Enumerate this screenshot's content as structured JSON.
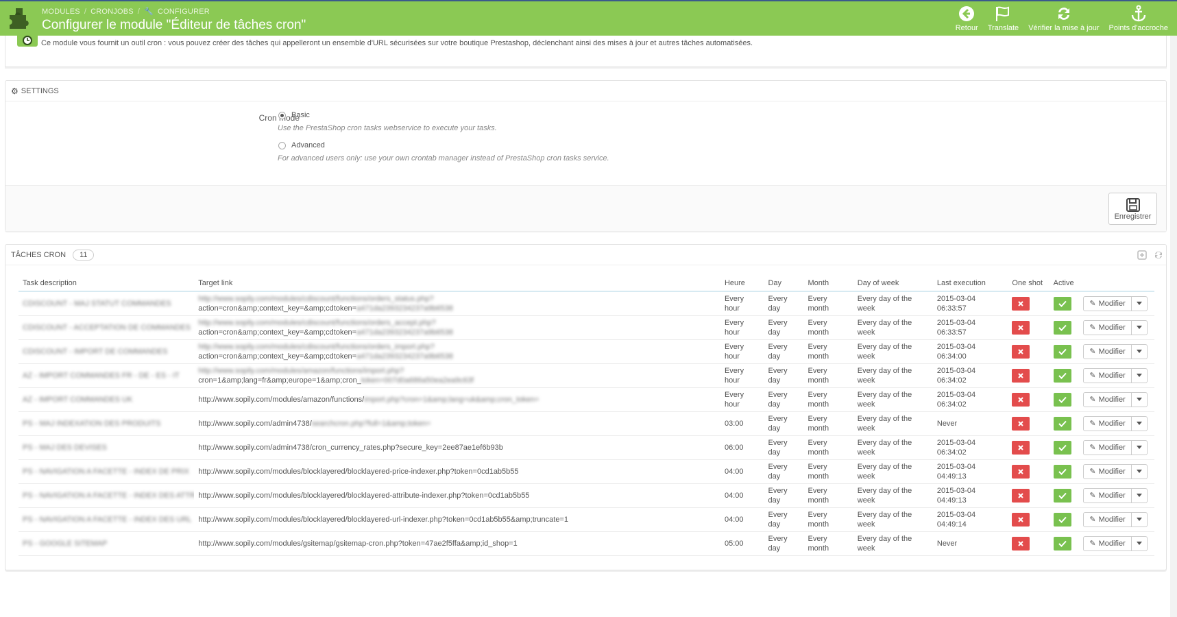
{
  "header": {
    "breadcrumb": [
      "MODULES",
      "CRONJOBS",
      "CONFIGURER"
    ],
    "title": "Configurer le module \"Éditeur de tâches cron\"",
    "toolbar": [
      {
        "label": "Retour",
        "icon": "back-icon"
      },
      {
        "label": "Translate",
        "icon": "flag-icon"
      },
      {
        "label": "Vérifier la mise à jour",
        "icon": "refresh-icon"
      },
      {
        "label": "Points d'accroche",
        "icon": "anchor-icon"
      }
    ]
  },
  "intro": {
    "text": "Ce module vous fournit un outil cron : vous pouvez créer des tâches qui appelleront un ensemble d'URL sécurisées sur votre boutique Prestashop, déclenchant ainsi des mises à jour et autres tâches automatisées."
  },
  "settings": {
    "heading": "SETTINGS",
    "cron_mode_label": "Cron mode",
    "options": [
      {
        "label": "Basic",
        "help": "Use the PrestaShop cron tasks webservice to execute your tasks.",
        "checked": true
      },
      {
        "label": "Advanced",
        "help": "For advanced users only: use your own crontab manager instead of PrestaShop cron tasks service.",
        "checked": false
      }
    ],
    "save_label": "Enregistrer"
  },
  "tasks": {
    "heading": "TÂCHES CRON",
    "count": "11",
    "columns": [
      "Task description",
      "Target link",
      "Heure",
      "Day",
      "Month",
      "Day of week",
      "Last execution",
      "One shot",
      "Active",
      ""
    ],
    "edit_label": "Modifier",
    "rows": [
      {
        "desc": "CDISCOUNT - MAJ STATUT COMMANDES",
        "link1": "http://www.sopily.com/modules/cdiscount/functions/orders_status.php?",
        "link2": "action=cron&amp;context_key=&amp;cdtoken=",
        "link3": "a471da2393234237a9b6538",
        "hour": "Every hour",
        "day": "Every day",
        "month": "Every month",
        "dow": "Every day of the week",
        "last": "2015-03-04 06:33:57"
      },
      {
        "desc": "CDISCOUNT - ACCEPTATION DE COMMANDES",
        "link1": "http://www.sopily.com/modules/cdiscount/functions/orders_accept.php?",
        "link2": "action=cron&amp;context_key=&amp;cdtoken=",
        "link3": "a471da2393234237a9b6538",
        "hour": "Every hour",
        "day": "Every day",
        "month": "Every month",
        "dow": "Every day of the week",
        "last": "2015-03-04 06:33:57"
      },
      {
        "desc": "CDISCOUNT - IMPORT DE COMMANDES",
        "link1": "http://www.sopily.com/modules/cdiscount/functions/orders_import.php?",
        "link2": "action=cron&amp;context_key=&amp;cdtoken=",
        "link3": "a471da2393234237a9b6538",
        "hour": "Every hour",
        "day": "Every day",
        "month": "Every month",
        "dow": "Every day of the week",
        "last": "2015-03-04 06:34:00"
      },
      {
        "desc": "AZ - IMPORT COMMANDES FR - DE - ES - IT",
        "link1": "http://www.sopily.com/modules/amazon/functions/import.php?",
        "link2": "cron=1&amp;lang=fr&amp;europe=1&amp;cron_",
        "link3": "token=007d0a686a50ea2ea9c63f",
        "hour": "Every hour",
        "day": "Every day",
        "month": "Every month",
        "dow": "Every day of the week",
        "last": "2015-03-04 06:34:02"
      },
      {
        "desc": "AZ - IMPORT COMMANDES UK",
        "link1": "",
        "link2": "http://www.sopily.com/modules/amazon/functions/",
        "link3": "import.php?cron=1&amp;lang=uk&amp;cron_token=",
        "hour": "Every hour",
        "day": "Every day",
        "month": "Every month",
        "dow": "Every day of the week",
        "last": "2015-03-04 06:34:02"
      },
      {
        "desc": "PS - MAJ INDEXATION DES PRODUITS",
        "link1": "",
        "link2": "http://www.sopily.com/admin4738/",
        "link3": "searchcron.php?full=1&amp;token=",
        "hour": "03:00",
        "day": "Every day",
        "month": "Every month",
        "dow": "Every day of the week",
        "last": "Never"
      },
      {
        "desc": "PS - MAJ DES DEVISES",
        "link1": "",
        "link2": "http://www.sopily.com/admin4738/cron_currency_rates.php?secure_key=2ee87ae1ef6b93b",
        "link3": "",
        "hour": "06:00",
        "day": "Every day",
        "month": "Every month",
        "dow": "Every day of the week",
        "last": "2015-03-04 06:34:02"
      },
      {
        "desc": "PS - NAVIGATION A FACETTE - INDEX DE PRIX",
        "link1": "",
        "link2": "http://www.sopily.com/modules/blocklayered/blocklayered-price-indexer.php?token=0cd1ab5b55",
        "link3": "",
        "hour": "04:00",
        "day": "Every day",
        "month": "Every month",
        "dow": "Every day of the week",
        "last": "2015-03-04 04:49:13"
      },
      {
        "desc": "PS - NAVIGATION A FACETTE - INDEX DES ATTRIBUTS",
        "link1": "",
        "link2": "http://www.sopily.com/modules/blocklayered/blocklayered-attribute-indexer.php?token=0cd1ab5b55",
        "link3": "",
        "hour": "04:00",
        "day": "Every day",
        "month": "Every month",
        "dow": "Every day of the week",
        "last": "2015-03-04 04:49:13"
      },
      {
        "desc": "PS - NAVIGATION A FACETTE - INDEX DES URL",
        "link1": "",
        "link2": "http://www.sopily.com/modules/blocklayered/blocklayered-url-indexer.php?token=0cd1ab5b55&amp;truncate=1",
        "link3": "",
        "hour": "04:00",
        "day": "Every day",
        "month": "Every month",
        "dow": "Every day of the week",
        "last": "2015-03-04 04:49:14"
      },
      {
        "desc": "PS - GOOGLE SITEMAP",
        "link1": "",
        "link2": "http://www.sopily.com/modules/gsitemap/gsitemap-cron.php?token=47ae2f5ffa&amp;id_shop=1",
        "link3": "",
        "hour": "05:00",
        "day": "Every day",
        "month": "Every month",
        "dow": "Every day of the week",
        "last": "Never"
      }
    ]
  },
  "colors": {
    "header_green": "#8bc954",
    "delete_red": "#e34c4c",
    "active_green": "#79c14f"
  }
}
